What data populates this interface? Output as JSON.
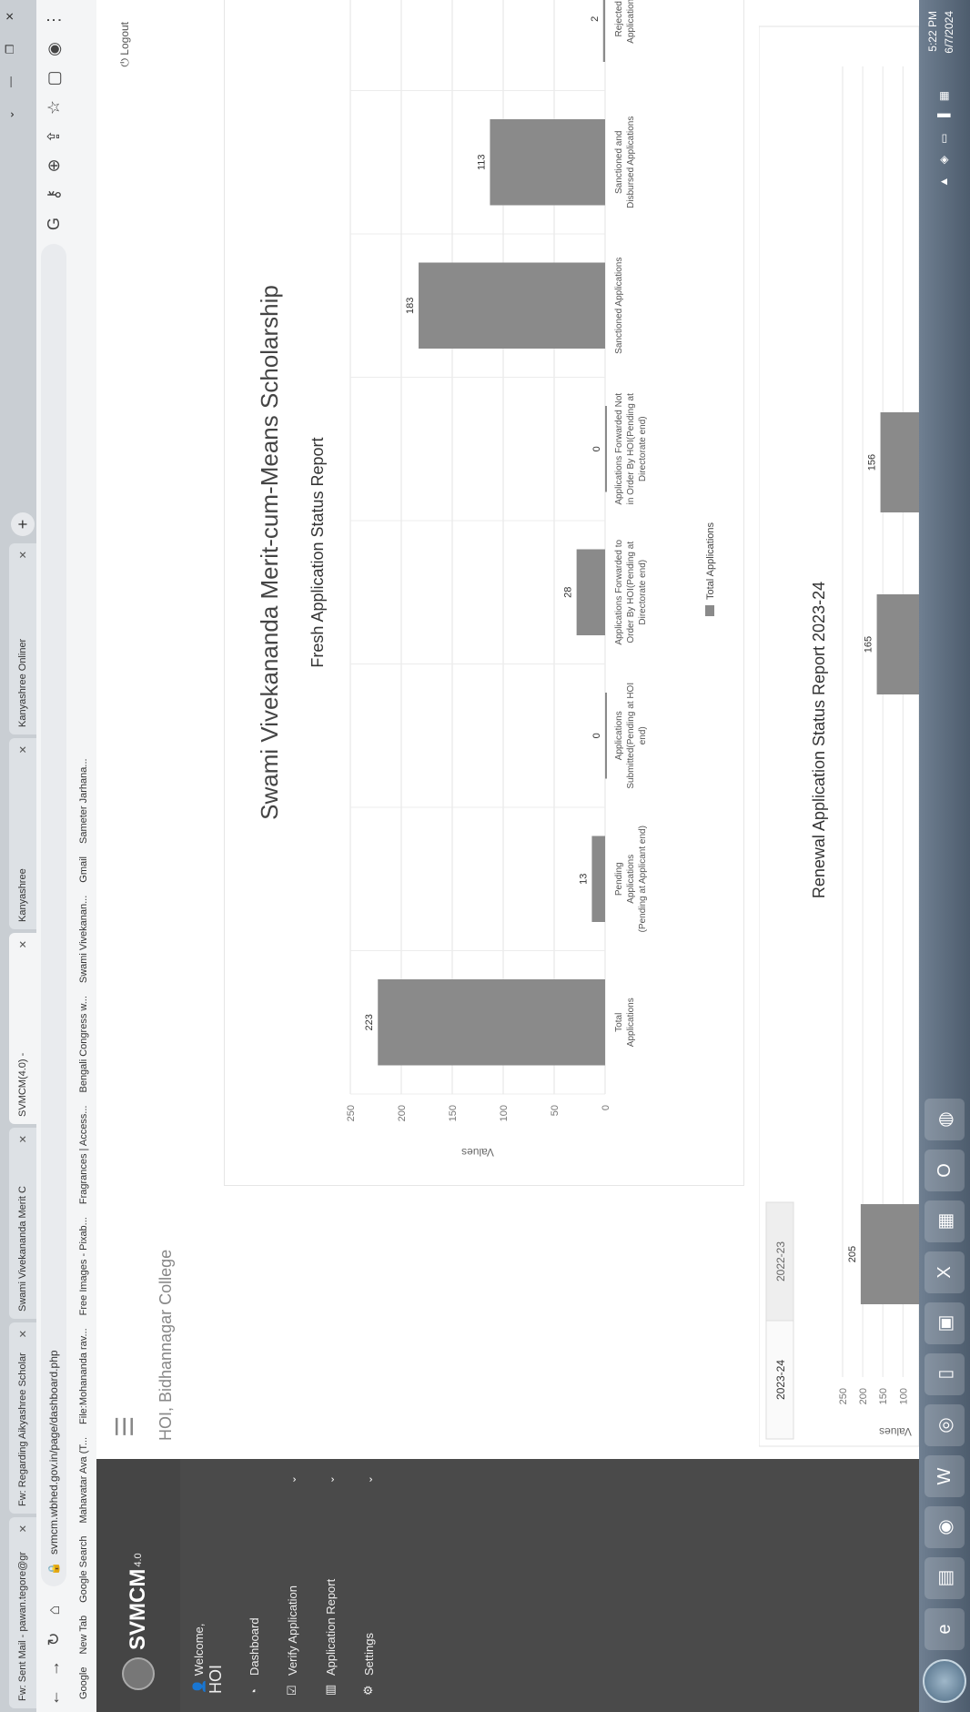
{
  "browser": {
    "tabs": [
      {
        "label": "Fw: Sent Mail - pawan.tegore@gr",
        "active": false
      },
      {
        "label": "Fw: Regarding Aikyashree Scholar",
        "active": false
      },
      {
        "label": "Swami Vivekananda Merit C",
        "active": false
      },
      {
        "label": "SVMCM(4.0) -",
        "active": true
      },
      {
        "label": "Kanyashree",
        "active": false
      },
      {
        "label": "Kanyashree Onliner",
        "active": false
      }
    ],
    "url": "svmcm.wbhed.gov.in/page/dashboard.php",
    "bookmarks": [
      "Google",
      "New Tab",
      "Google Search",
      "Mahavatar Ava (T...",
      "File:Mohananda rav...",
      "Free Images - Pixab...",
      "Fragrances | Access...",
      "Bengali Congress w...",
      "Swami Vivekanan...",
      "Gmail",
      "Sameter Jarhana..."
    ]
  },
  "sidebar": {
    "brand": "SVMCM",
    "brand_suffix": "4.0",
    "welcome": "Welcome,",
    "role": "HOI",
    "items": [
      {
        "label": "Dashboard",
        "icon": "dashboard-icon",
        "has_chevron": false
      },
      {
        "label": "Verify Application",
        "icon": "check-square-icon",
        "has_chevron": true
      },
      {
        "label": "Application Report",
        "icon": "bar-chart-icon",
        "has_chevron": true
      },
      {
        "label": "Settings",
        "icon": "gear-icon",
        "has_chevron": true
      }
    ]
  },
  "header": {
    "logout": "Logout",
    "college": "HOI, Bidhannagar College"
  },
  "page_title": "Swami Vivekananda Merit-cum-Means Scholarship",
  "chart_data": [
    {
      "type": "bar",
      "title": "Fresh Application Status Report",
      "ylabel": "Values",
      "ylim": [
        0,
        250
      ],
      "yticks": [
        0,
        50,
        100,
        150,
        200,
        250
      ],
      "categories": [
        [
          "Total",
          "Applications"
        ],
        [
          "Pending",
          "Applications",
          "(Pending at Applicant end)"
        ],
        [
          "Applications",
          "Submitted(Pending at HOI",
          "end)"
        ],
        [
          "Applications Forwarded to",
          "Order By HOI(Pending at",
          "Directorate end)"
        ],
        [
          "Applications Forwarded Not",
          "in Order By HOI(Pending at",
          "Directorate end)"
        ],
        [
          "Sanctioned Applications"
        ],
        [
          "Sanctioned and",
          "Disbursed Applications"
        ],
        [
          "Rejected",
          "Applications"
        ]
      ],
      "series": [
        {
          "name": "Total Applications",
          "values": [
            223,
            13,
            0,
            28,
            0,
            183,
            113,
            2
          ]
        }
      ],
      "legend": "bottom"
    },
    {
      "type": "bar",
      "title": "Renewal Application Status Report 2023-24",
      "ylabel": "Values",
      "ylim": [
        0,
        250
      ],
      "yticks": [
        100,
        150,
        200,
        250
      ],
      "series": [
        {
          "name": "",
          "values": [
            205,
            165,
            156
          ]
        }
      ]
    }
  ],
  "renewal_tabs": [
    "2023-24",
    "2022-23"
  ],
  "taskbar": {
    "time": "5:22 PM",
    "date": "6/7/2024"
  }
}
